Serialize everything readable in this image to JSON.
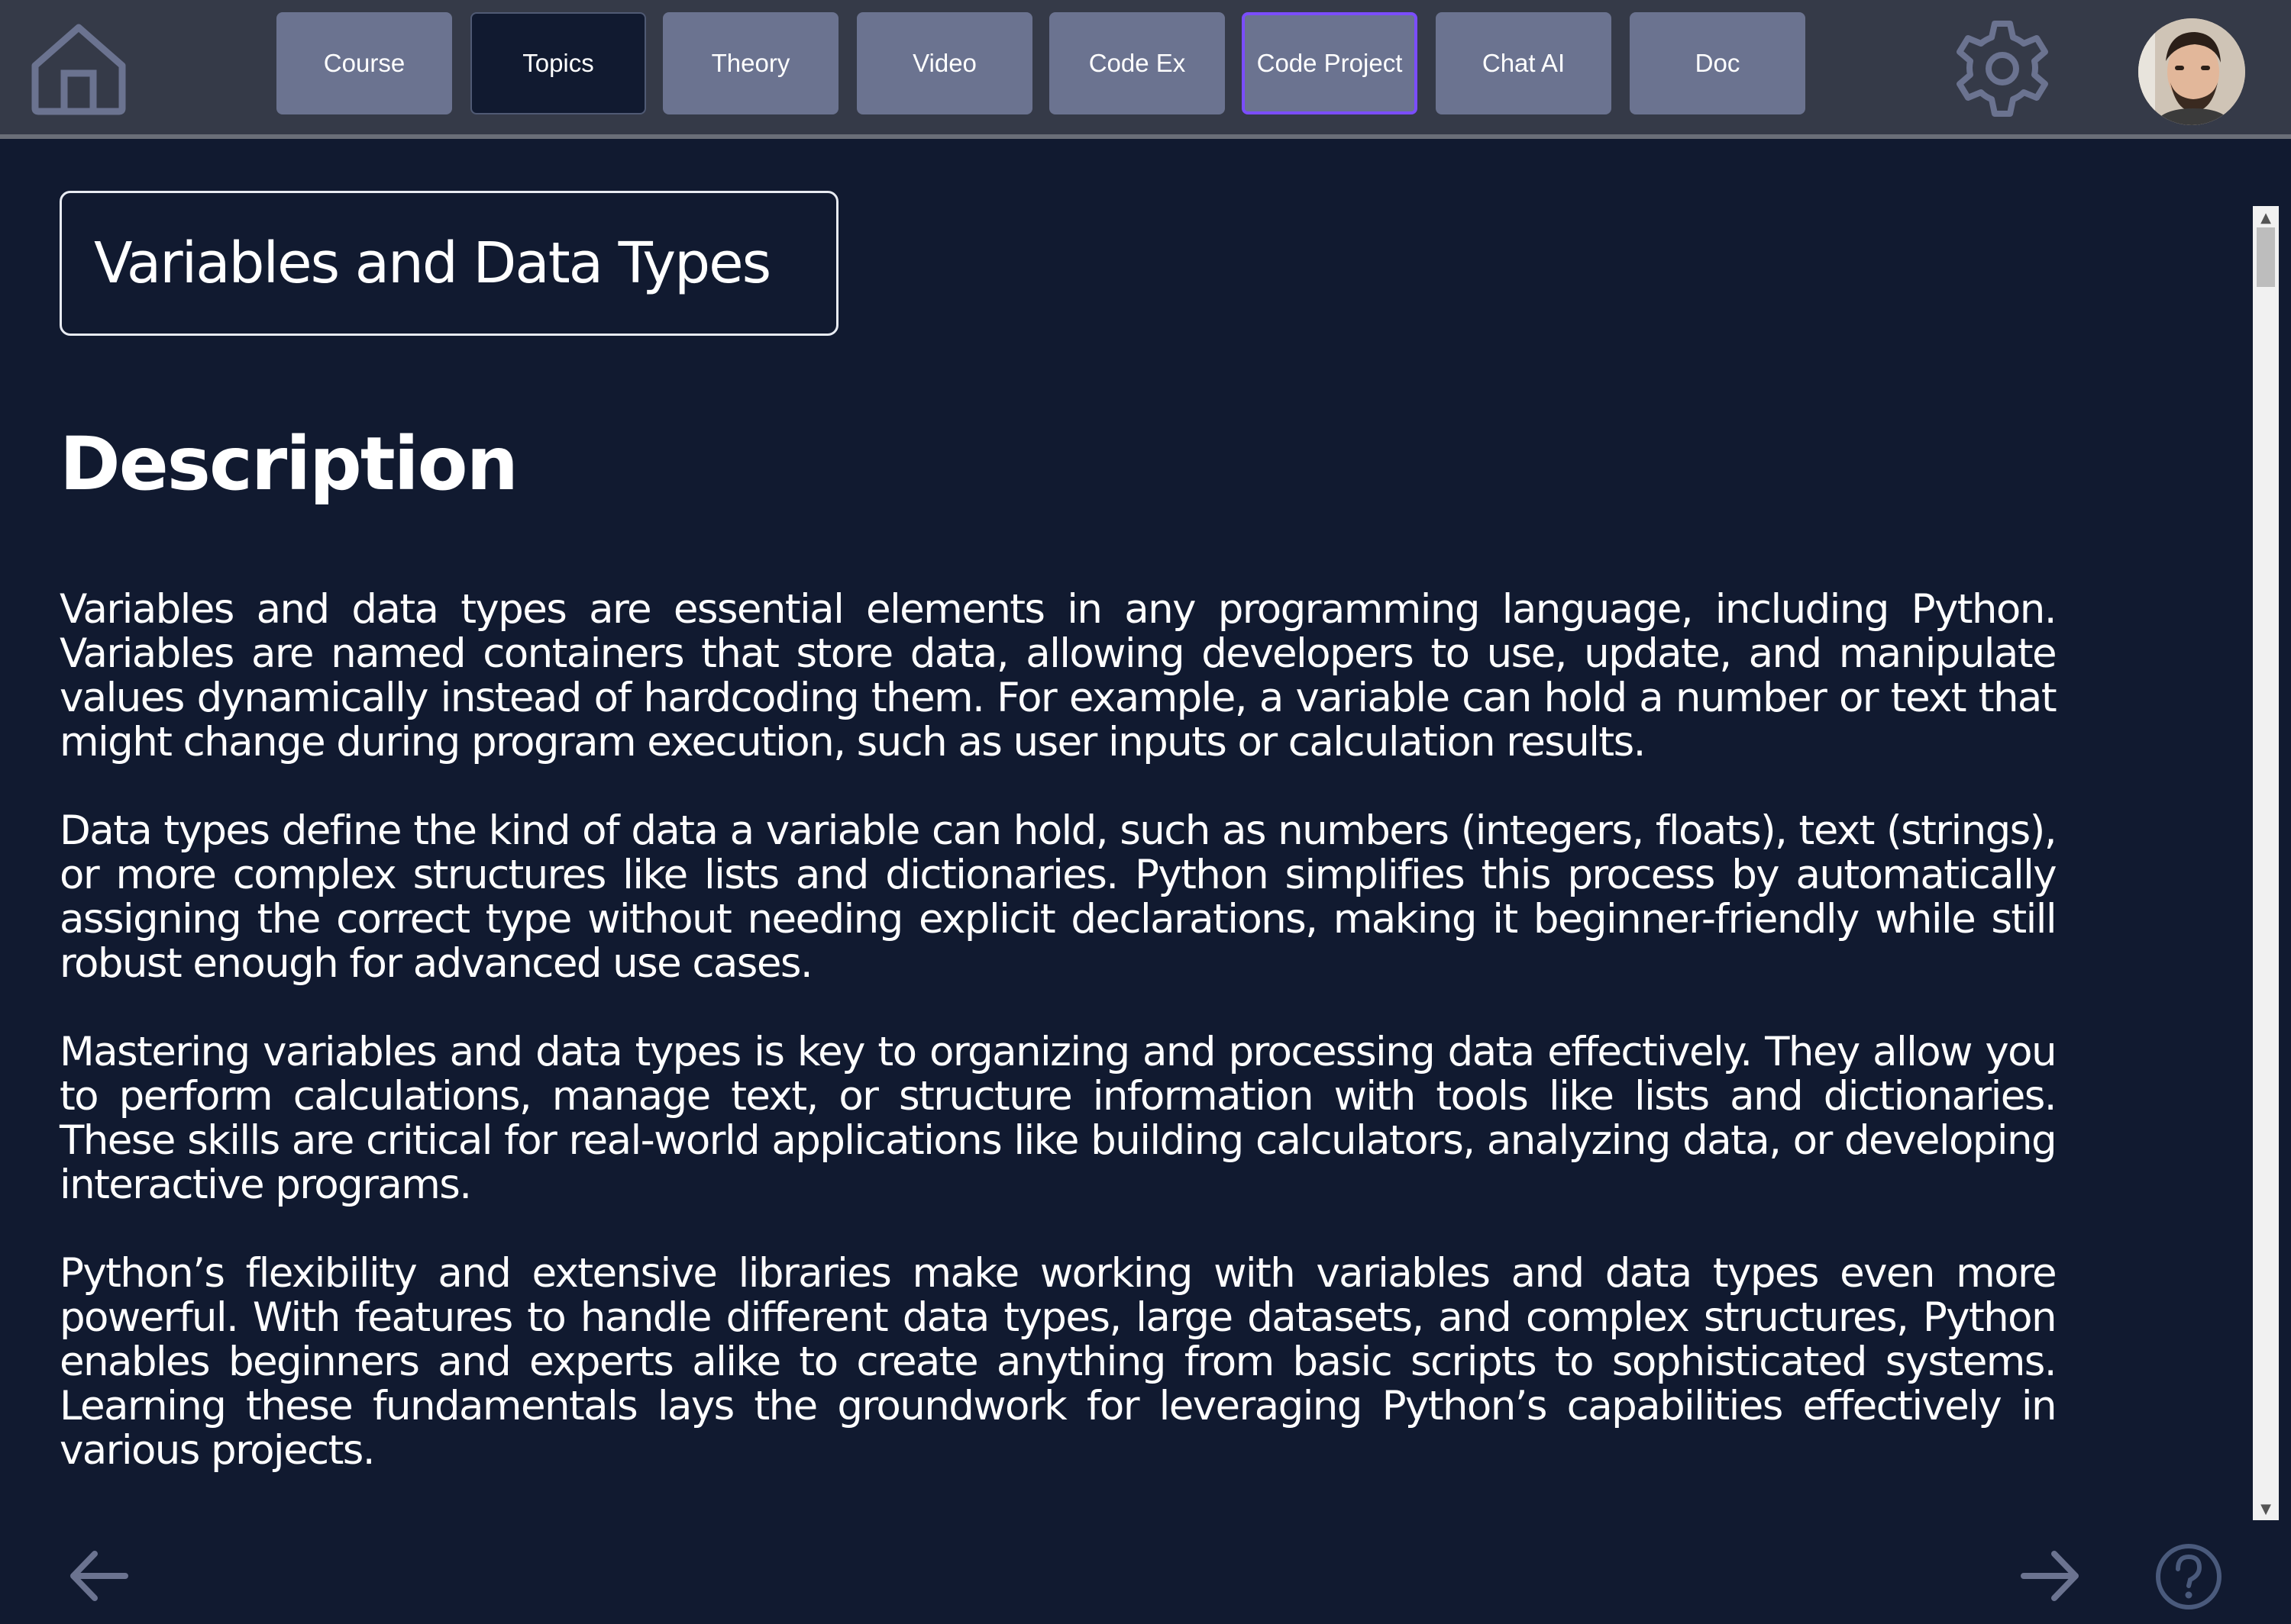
{
  "nav": {
    "tabs": [
      {
        "label": "Course"
      },
      {
        "label": "Topics"
      },
      {
        "label": "Theory"
      },
      {
        "label": "Video"
      },
      {
        "label": "Code Ex"
      },
      {
        "label": "Code Project"
      },
      {
        "label": "Chat AI"
      },
      {
        "label": "Doc"
      }
    ],
    "active_tab": "Topics",
    "focused_tab": "Code Project",
    "icons": {
      "home": "home-icon",
      "settings": "gear-icon",
      "avatar": "user-avatar"
    }
  },
  "main": {
    "title": "Variables and Data Types",
    "section_heading": "Description",
    "paragraphs": [
      "Variables and data types are essential elements in any programming language, including Python. Variables are named containers that store data, allowing developers to use, update, and manipulate values dynamically instead of hardcoding them. For example, a variable can hold a number or text that might change during program execution, such as user inputs or calculation results.",
      "Data types define the kind of data a variable can hold, such as numbers (integers, floats), text (strings), or more complex structures like lists and dictionaries. Python simplifies this process by automatically assigning the correct type without needing explicit declarations, making it beginner-friendly while still robust enough for advanced use cases.",
      "Mastering variables and data types is key to organizing and processing data effectively. They allow you to perform calculations, manage text, or structure information with tools like lists and dictionaries. These skills are critical for real-world applications like building calculators, analyzing data, or developing interactive programs.",
      "Python’s flexibility and extensive libraries make working with variables and data types even more powerful. With features to handle different data types, large datasets, and complex structures, Python enables beginners and experts alike to create anything from basic scripts to sophisticated systems. Learning these fundamentals lays the groundwork for leveraging Python’s capabilities effectively in various projects."
    ]
  },
  "footer": {
    "icons": {
      "prev": "arrow-left-icon",
      "next": "arrow-right-icon",
      "help": "help-icon"
    }
  },
  "colors": {
    "background": "#111a30",
    "topbar": "#353a48",
    "tab": "#6b7390",
    "tab_active": "#111a30",
    "focus_outline": "#7b4dff",
    "icon_stroke": "#6b7390"
  }
}
